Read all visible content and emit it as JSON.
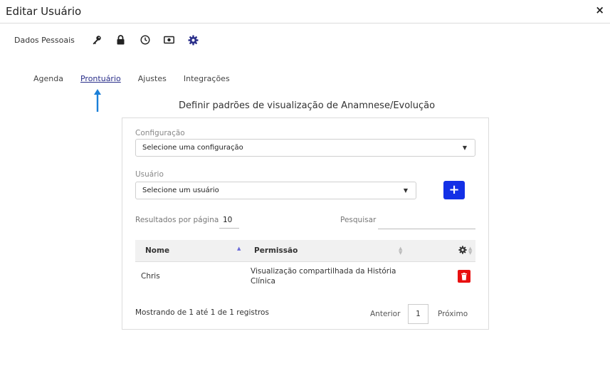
{
  "dialog": {
    "title": "Editar Usuário",
    "close_label": "×"
  },
  "subnav": {
    "label": "Dados Pessoais",
    "icons": [
      "key-icon",
      "lock-icon",
      "clock-icon",
      "money-icon",
      "gear-icon"
    ],
    "active_color": "#2a2f8a"
  },
  "tabs": [
    {
      "label": "Agenda",
      "active": false
    },
    {
      "label": "Prontuário",
      "active": true
    },
    {
      "label": "Ajustes",
      "active": false
    },
    {
      "label": "Integrações",
      "active": false
    }
  ],
  "section": {
    "title": "Definir padrões de visualização de Anamnese/Evolução"
  },
  "form": {
    "config_label": "Configuração",
    "config_value": "Selecione uma configuração",
    "user_label": "Usuário",
    "user_value": "Selecione um usuário",
    "add_label": "+"
  },
  "table_controls": {
    "rpp_label": "Resultados por página",
    "rpp_value": "10",
    "search_label": "Pesquisar",
    "search_value": ""
  },
  "table": {
    "headers": [
      "Nome",
      "Permissão"
    ],
    "rows": [
      {
        "nome": "Chris",
        "permissao": "Visualização compartilhada da História Clínica"
      }
    ]
  },
  "footer": {
    "info": "Mostrando de 1 até 1 de 1 registros",
    "prev": "Anterior",
    "page": "1",
    "next": "Próximo"
  },
  "colors": {
    "primary": "#1330e6",
    "danger": "#e81010",
    "arrow": "#1a7fd8"
  }
}
